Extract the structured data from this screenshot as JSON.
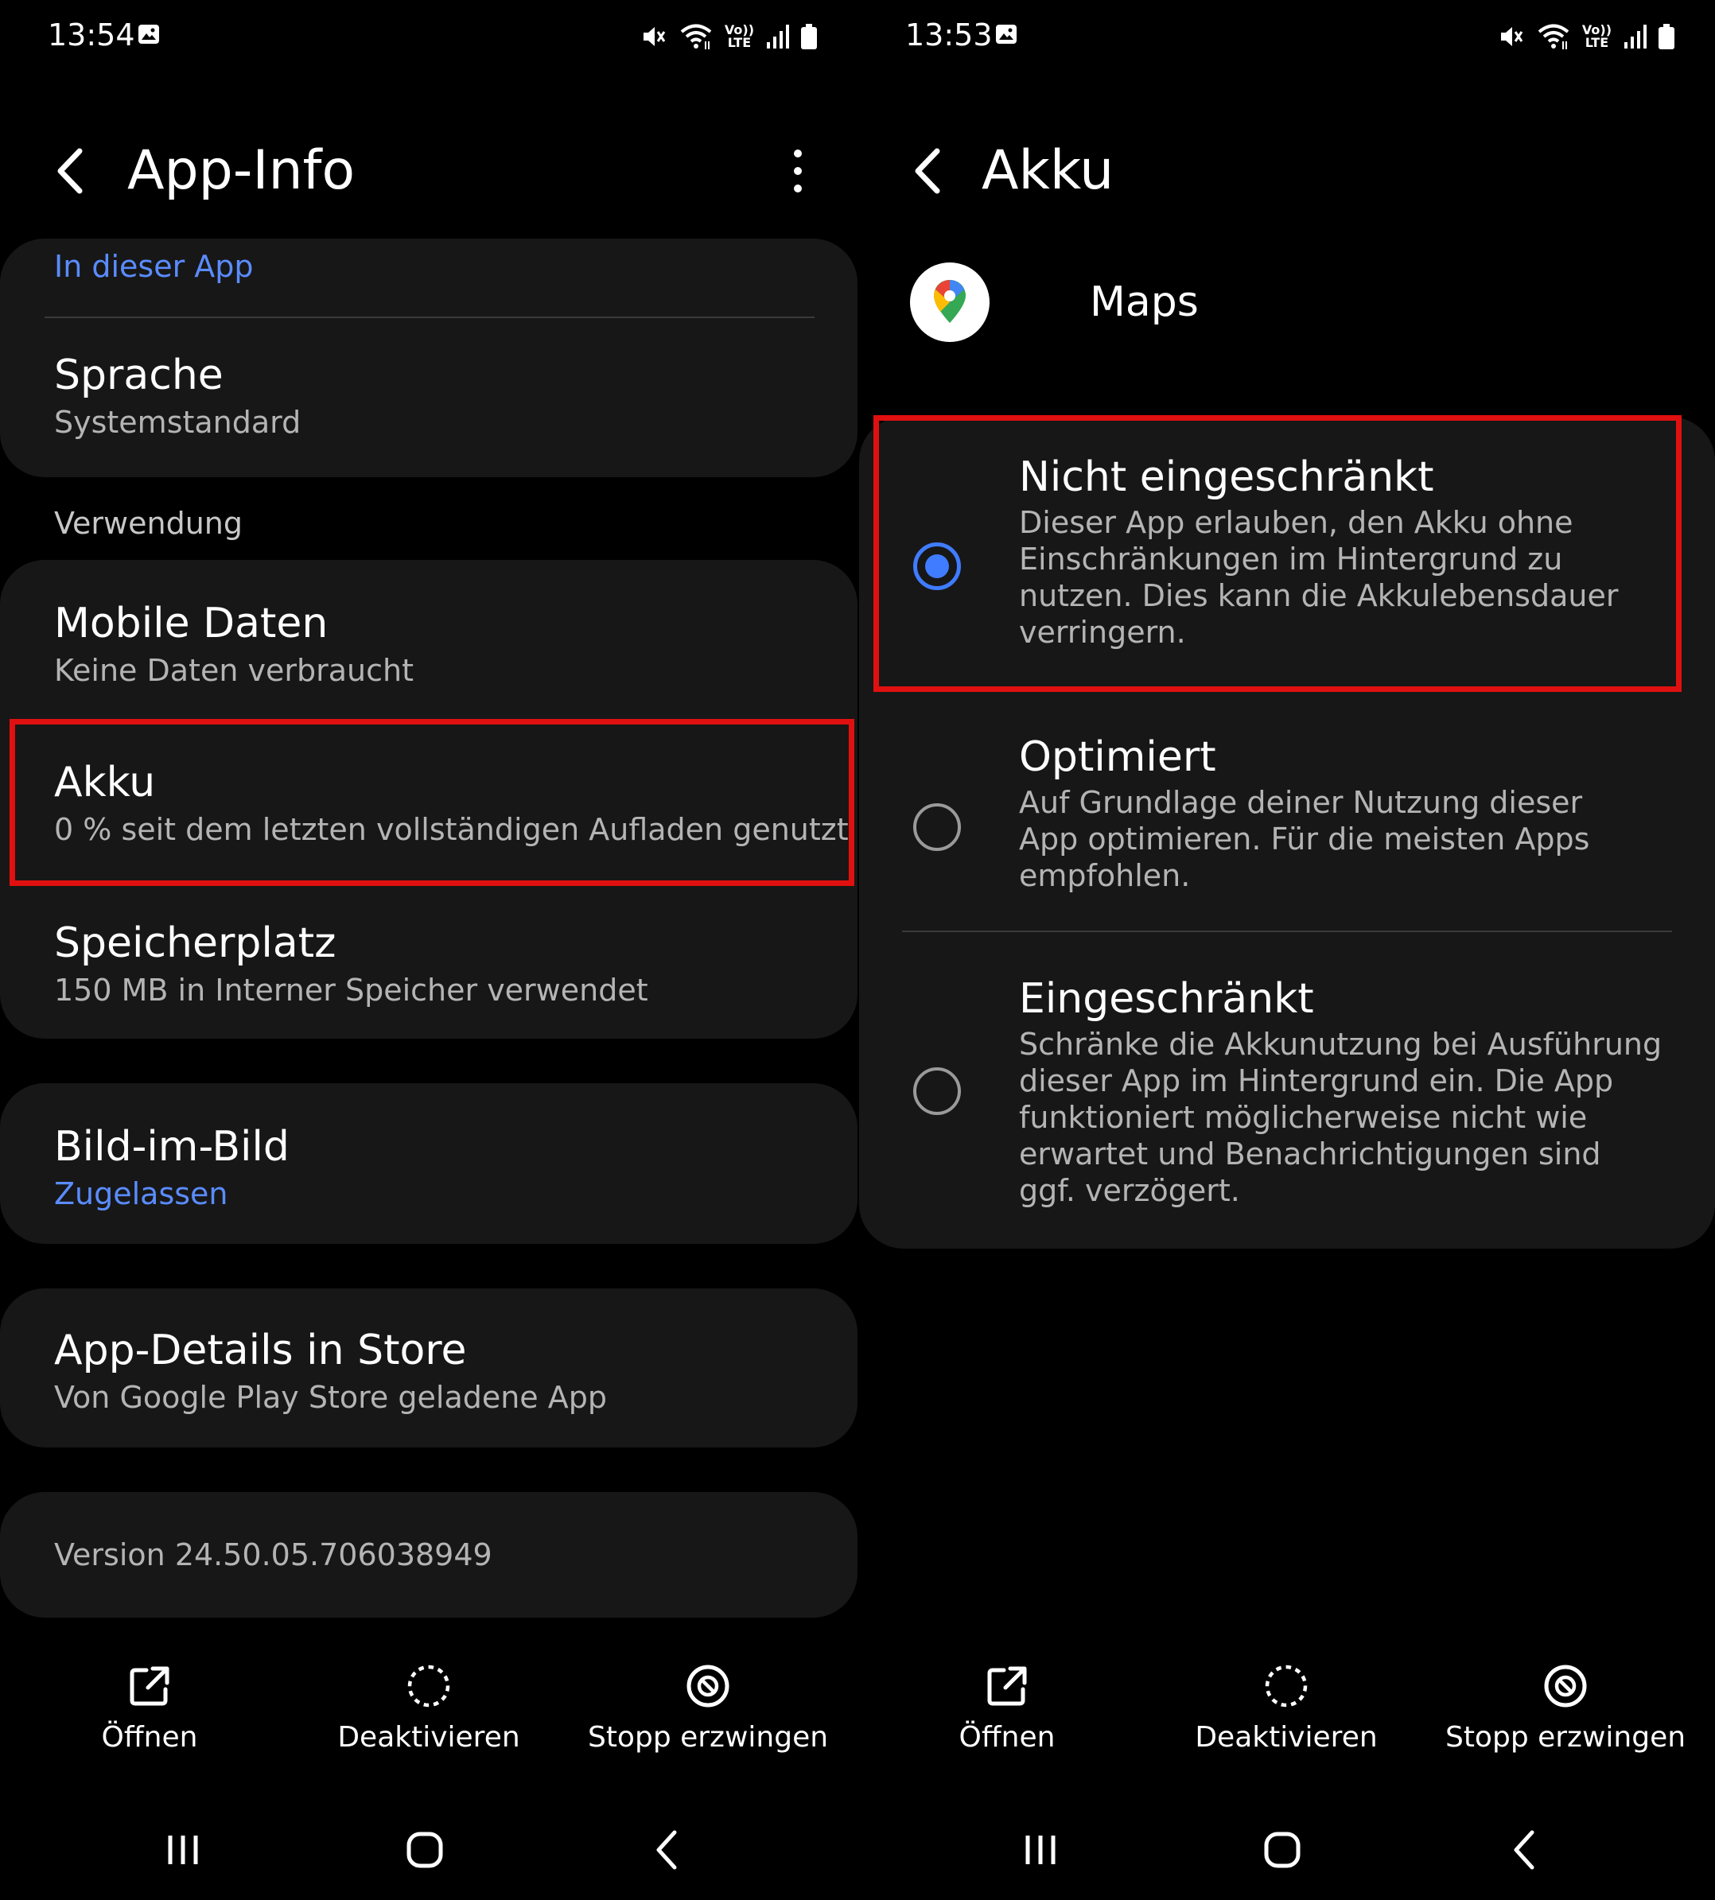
{
  "left": {
    "status": {
      "time": "13:54"
    },
    "appbar": {
      "title": "App-Info"
    },
    "items": {
      "notifications_sub": "In dieser App",
      "language_title": "Sprache",
      "language_sub": "Systemstandard",
      "usage_section": "Verwendung",
      "mobile_title": "Mobile Daten",
      "mobile_sub": "Keine Daten verbraucht",
      "battery_title": "Akku",
      "battery_sub": "0 % seit dem letzten vollständigen Aufladen genutzt",
      "storage_title": "Speicherplatz",
      "storage_sub": "150 MB in Interner Speicher verwendet",
      "pip_title": "Bild-im-Bild",
      "pip_sub": "Zugelassen",
      "store_title": "App-Details in Store",
      "store_sub": "Von Google Play Store geladene App",
      "version": "Version 24.50.05.706038949"
    }
  },
  "right": {
    "status": {
      "time": "13:53"
    },
    "appbar": {
      "title": "Akku"
    },
    "app_name": "Maps",
    "options": [
      {
        "title": "Nicht eingeschränkt",
        "desc": "Dieser App erlauben, den Akku ohne\nEinschränkungen im Hintergrund zu\nnutzen. Dies kann die Akkulebensdauer\nverringern.",
        "selected": true
      },
      {
        "title": "Optimiert",
        "desc": "Auf Grundlage deiner Nutzung dieser\nApp optimieren. Für die meisten Apps\nempfohlen.",
        "selected": false
      },
      {
        "title": "Eingeschränkt",
        "desc": "Schränke die Akkunutzung bei Ausführung\ndieser App im Hintergrund ein. Die App\nfunktioniert möglicherweise nicht wie\nerwartet und Benachrichtigungen sind\nggf. verzögert.",
        "selected": false
      }
    ]
  },
  "bottom_actions": {
    "open": "Öffnen",
    "disable": "Deaktivieren",
    "force_stop": "Stopp erzwingen"
  },
  "status_icons": {
    "volte_top": "Vo))",
    "volte_bottom": "LTE"
  },
  "colors": {
    "accent": "#3f7cff",
    "link": "#5a8cff",
    "highlight": "#e01010",
    "card": "#171717",
    "background": "#000000"
  },
  "icons": [
    "gallery-icon",
    "mute-icon",
    "wifi-icon",
    "signal-icon",
    "battery-icon",
    "back-arrow-icon",
    "more-options-icon",
    "maps-pin-icon",
    "open-external-icon",
    "disable-icon",
    "force-stop-icon",
    "recents-icon",
    "home-icon",
    "nav-back-icon"
  ]
}
